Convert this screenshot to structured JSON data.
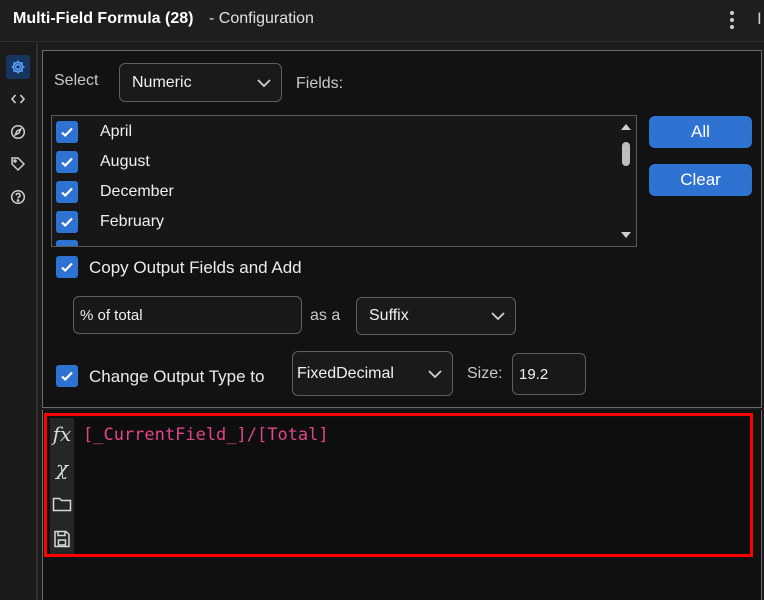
{
  "header": {
    "title": "Multi-Field Formula (28)",
    "subtitle": "- Configuration",
    "edge_char": "Ⅰ"
  },
  "sidebar": {
    "icons": [
      "gear-icon",
      "code-icon",
      "compass-icon",
      "tag-icon",
      "help-icon"
    ],
    "active": "gear-icon"
  },
  "config": {
    "select_label": "Select",
    "select_value": "Numeric",
    "fields_label": "Fields:",
    "fields": [
      {
        "name": "April",
        "checked": true
      },
      {
        "name": "August",
        "checked": true
      },
      {
        "name": "December",
        "checked": true
      },
      {
        "name": "February",
        "checked": true
      }
    ],
    "all_button": "All",
    "clear_button": "Clear",
    "copy_output_label": "Copy Output Fields and Add",
    "copy_output_checked": true,
    "suffix_text": "% of total",
    "as_a_label": "as a",
    "position_value": "Suffix",
    "change_type_label": "Change Output Type to",
    "change_type_checked": true,
    "type_value": "FixedDecimal",
    "size_label": "Size:",
    "size_value": "19.2"
  },
  "formula": {
    "fx_label": "fx",
    "x_label": "χ",
    "expression": "[_CurrentField_]/[Total]"
  },
  "colors": {
    "accent": "#2e72d2",
    "formula_text": "#e0458a",
    "highlight": "#ff0000"
  }
}
